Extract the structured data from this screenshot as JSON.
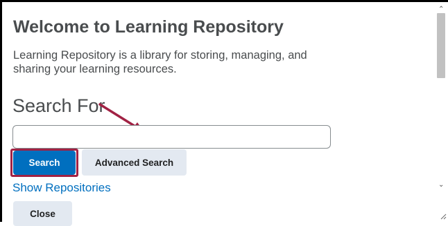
{
  "dialog": {
    "title": "Welcome to Learning Repository",
    "description": "Learning Repository is a library for storing, managing, and sharing your learning resources.",
    "search_heading": "Search For",
    "search_input": {
      "value": "",
      "placeholder": ""
    },
    "buttons": {
      "search": "Search",
      "advanced_search": "Advanced Search",
      "close": "Close"
    },
    "link_show_repositories": "Show Repositories"
  },
  "scrollbar": {
    "up_icon": "chevron-up-icon",
    "down_icon": "chevron-down-icon"
  },
  "colors": {
    "primary": "#006fbf",
    "highlight": "#a12244",
    "secondary_button": "#e3e9f1",
    "heading_text": "#494c4e"
  }
}
